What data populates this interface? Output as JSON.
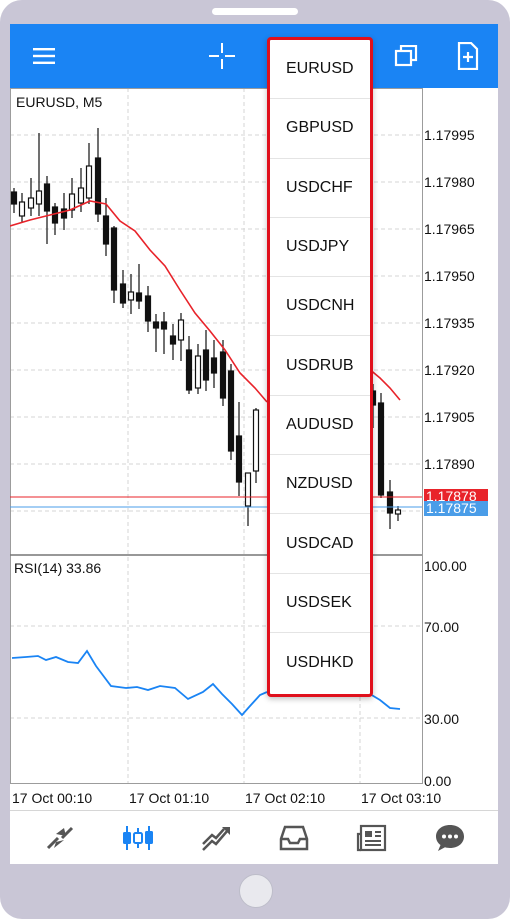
{
  "toolbar": {
    "menu_icon": "hamburger-menu-icon",
    "crosshair_icon": "crosshair-icon",
    "windows_icon": "overlapping-windows-icon",
    "new_chart_icon": "new-document-plus-icon"
  },
  "main_chart": {
    "symbol_label": "EURUSD, M5",
    "price_labels": [
      "1.17995",
      "1.17980",
      "1.17965",
      "1.17950",
      "1.17935",
      "1.17920",
      "1.17905",
      "1.17890"
    ],
    "bid_badge": "1.17878",
    "ask_badge": "1.17875",
    "bid_color": "#e8232a",
    "ask_color": "#4a9de8",
    "ma_color": "#e8232a"
  },
  "rsi_panel": {
    "label": "RSI(14) 33.86",
    "levels": [
      "100.00",
      "70.00",
      "30.00",
      "0.00"
    ],
    "line_color": "#1a84f4"
  },
  "time_axis": [
    "17 Oct 00:10",
    "17 Oct 01:10",
    "17 Oct 02:10",
    "17 Oct 03:10"
  ],
  "symbol_menu": {
    "items": [
      "EURUSD",
      "GBPUSD",
      "USDCHF",
      "USDJPY",
      "USDCNH",
      "USDRUB",
      "AUDUSD",
      "NZDUSD",
      "USDCAD",
      "USDSEK",
      "USDHKD"
    ],
    "highlight_color": "#e0101c"
  },
  "bottom_nav": [
    {
      "name": "quotes-icon"
    },
    {
      "name": "chart-icon"
    },
    {
      "name": "trade-icon"
    },
    {
      "name": "history-inbox-icon"
    },
    {
      "name": "news-icon"
    },
    {
      "name": "chat-icon"
    }
  ]
}
